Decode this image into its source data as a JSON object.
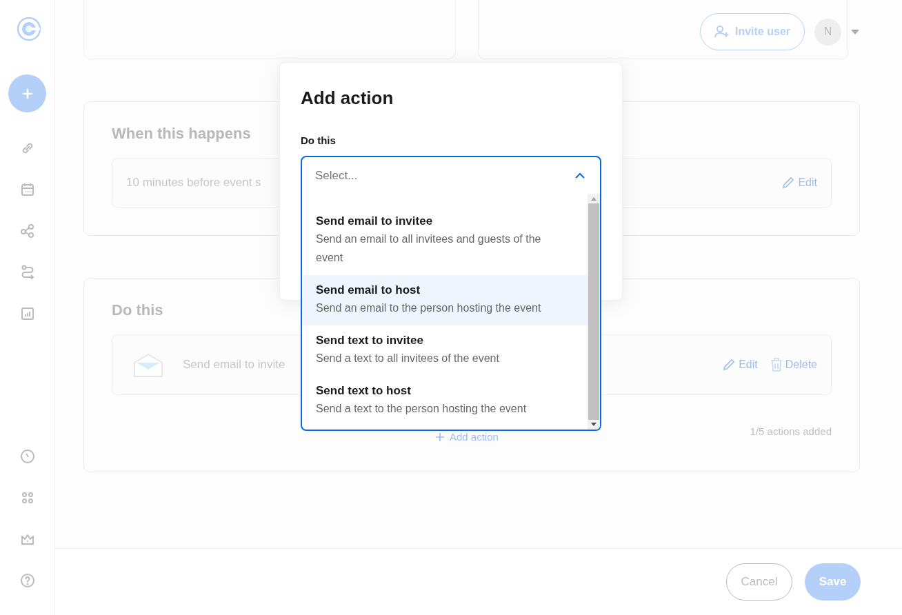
{
  "header": {
    "invite_button": "Invite user",
    "avatar": "N"
  },
  "trigger_card": {
    "title": "When this happens",
    "row_text": "10 minutes before event s",
    "edit": "Edit"
  },
  "actions_card": {
    "title": "Do this",
    "actions": [
      {
        "text": "Send email to invite",
        "edit": "Edit",
        "delete": "Delete"
      }
    ],
    "add_action": "Add action",
    "count": "1/5 actions added"
  },
  "footer": {
    "cancel": "Cancel",
    "save": "Save"
  },
  "modal": {
    "title": "Add action",
    "field_label": "Do this",
    "select": {
      "placeholder": "Select...",
      "expanded": true
    },
    "options": [
      {
        "title": "Send email to invitee",
        "description": "Send an email to all invitees and guests of the event",
        "highlighted": false
      },
      {
        "title": "Send email to host",
        "description": "Send an email to the person hosting the event",
        "highlighted": true
      },
      {
        "title": "Send text to invitee",
        "description": "Send a text to all invitees of the event",
        "highlighted": false
      },
      {
        "title": "Send text to host",
        "description": "Send a text to the person hosting the event",
        "highlighted": false
      }
    ]
  }
}
